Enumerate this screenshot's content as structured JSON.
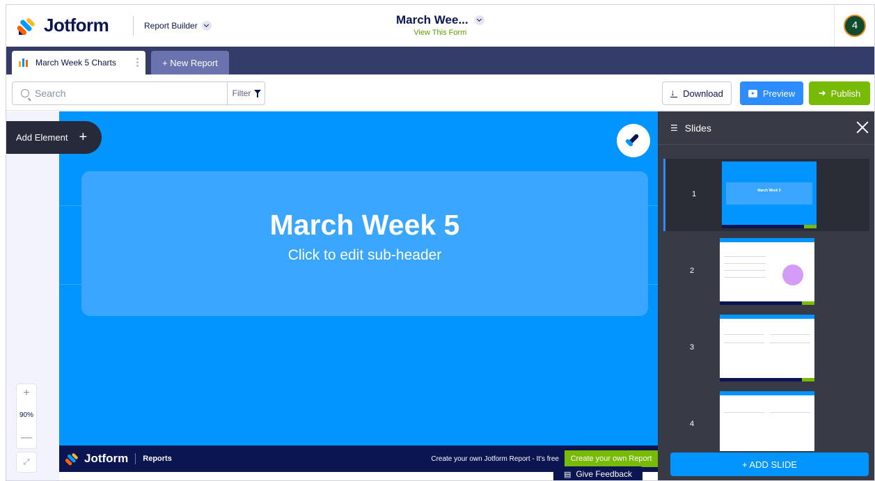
{
  "brand": {
    "name": "Jotform",
    "accent": "#0294ff",
    "navy": "#0a1551",
    "green": "#78bb07"
  },
  "header": {
    "app_switcher": "Report Builder",
    "form_title": "March Wee...",
    "form_link": "View This Form",
    "avatar_text": "4"
  },
  "tabs": {
    "active_label": "March Week 5 Charts",
    "new_label": "+ New Report"
  },
  "toolbar": {
    "search_placeholder": "Search",
    "filter_label": "Filter",
    "download_label": "Download",
    "preview_label": "Preview",
    "publish_label": "Publish"
  },
  "left": {
    "add_element_label": "Add Element",
    "zoom_in": "+",
    "zoom_value": "90%",
    "zoom_out": "—",
    "fit_icon": "⤢"
  },
  "slide": {
    "title": "March Week 5",
    "subtitle": "Click to edit sub-header",
    "footer_brand": "Jotform",
    "footer_reports": "Reports",
    "footer_promo": "Create your own Jotform Report - It's free",
    "footer_cta": "Create your own Report"
  },
  "feedback_label": "Give Feedback",
  "panel": {
    "title": "Slides",
    "slides": [
      {
        "number": "1",
        "title": "March Week 5"
      },
      {
        "number": "2"
      },
      {
        "number": "3"
      },
      {
        "number": "4"
      }
    ],
    "add_slide_label": "+ ADD SLIDE"
  }
}
